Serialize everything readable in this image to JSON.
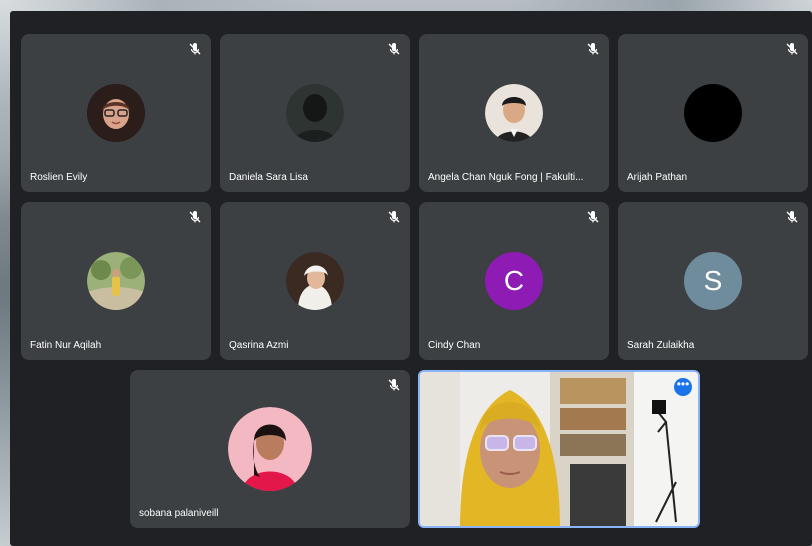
{
  "participants": [
    {
      "name": "Roslien Evily",
      "muted": true,
      "avatar": "photo-memoji"
    },
    {
      "name": "Daniela Sara Lisa",
      "muted": true,
      "avatar": "photo-dark"
    },
    {
      "name": "Angela Chan Nguk Fong | Fakulti...",
      "muted": true,
      "avatar": "photo-woman"
    },
    {
      "name": "Arijah Pathan",
      "muted": true,
      "avatar": "photo-black"
    },
    {
      "name": "Fatin Nur Aqilah",
      "muted": true,
      "avatar": "photo-outdoor"
    },
    {
      "name": "Qasrina Azmi",
      "muted": true,
      "avatar": "photo-hijab"
    },
    {
      "name": "Cindy Chan",
      "muted": true,
      "avatar": "initial",
      "initial": "C",
      "color": "#8e1bb4"
    },
    {
      "name": "Sarah Zulaikha",
      "muted": true,
      "avatar": "initial",
      "initial": "S",
      "color": "#6f8c9c"
    },
    {
      "name": "sobana palaniveill",
      "muted": true,
      "avatar": "photo-pink"
    }
  ],
  "self_view": {
    "more_label": "•••",
    "accent": "#1a73e8"
  },
  "colors": {
    "tile_bg": "#3c4043",
    "stage_bg": "#202124",
    "highlight_border": "#8ab4f8"
  }
}
